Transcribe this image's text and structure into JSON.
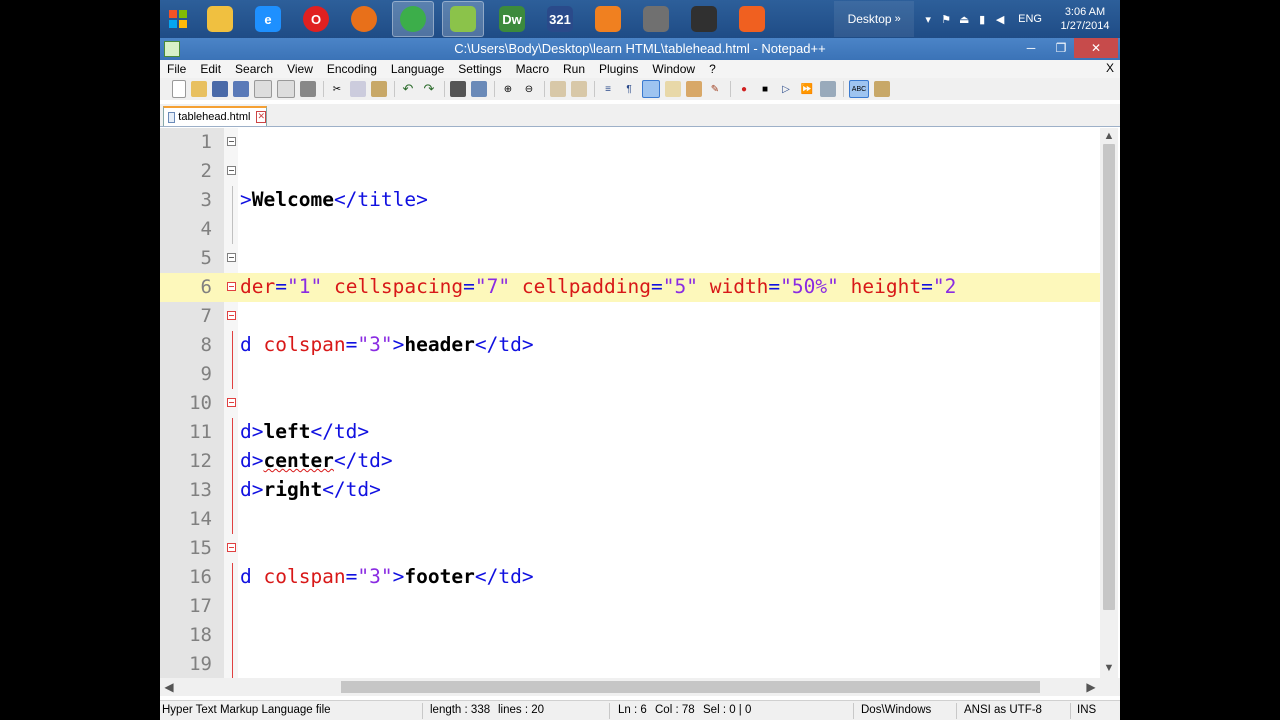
{
  "taskbar": {
    "apps": [
      {
        "name": "file-explorer",
        "label": "",
        "color": "#f0c040"
      },
      {
        "name": "internet-explorer",
        "label": "e",
        "color": "#1e90ff"
      },
      {
        "name": "opera",
        "label": "O",
        "color": "#e02020"
      },
      {
        "name": "firefox",
        "label": "",
        "color": "#e8701a"
      },
      {
        "name": "chrome",
        "label": "",
        "color": "#3cae4a"
      },
      {
        "name": "notepad-plus-plus",
        "label": "",
        "color": "#8bc34a"
      },
      {
        "name": "dreamweaver",
        "label": "Dw",
        "color": "#3c8a3c"
      },
      {
        "name": "media-player-321",
        "label": "321",
        "color": "#2a4a8a"
      },
      {
        "name": "vlc-player",
        "label": "",
        "color": "#f08020"
      },
      {
        "name": "app-placeholder",
        "label": "",
        "color": "#707070"
      },
      {
        "name": "video-app",
        "label": "",
        "color": "#303030"
      },
      {
        "name": "xampp",
        "label": "",
        "color": "#f06020"
      }
    ],
    "desktop_label": "Desktop",
    "language": "ENG",
    "time": "3:06 AM",
    "date": "1/27/2014"
  },
  "window": {
    "title": "C:\\Users\\Body\\Desktop\\learn HTML\\tablehead.html - Notepad++"
  },
  "menu": {
    "items": [
      "File",
      "Edit",
      "Search",
      "View",
      "Encoding",
      "Language",
      "Settings",
      "Macro",
      "Run",
      "Plugins",
      "Window",
      "?"
    ],
    "close": "X"
  },
  "tab": {
    "label": "tablehead.html"
  },
  "editor": {
    "highlighted_line": 6,
    "lines": [
      {
        "n": "1",
        "fold": "box",
        "code": []
      },
      {
        "n": "2",
        "fold": "box",
        "code": []
      },
      {
        "n": "3",
        "fold": "line",
        "code": [
          {
            "t": "tag",
            "v": ">"
          },
          {
            "t": "txt",
            "v": "Welcome"
          },
          {
            "t": "tag",
            "v": "</title>"
          }
        ]
      },
      {
        "n": "4",
        "fold": "line",
        "code": []
      },
      {
        "n": "5",
        "fold": "box",
        "code": []
      },
      {
        "n": "6",
        "fold": "boxred",
        "code": [
          {
            "t": "attr",
            "v": "der"
          },
          {
            "t": "tag",
            "v": "="
          },
          {
            "t": "val",
            "v": "\"1\""
          },
          {
            "t": "tag",
            "v": " "
          },
          {
            "t": "attr",
            "v": "cellspacing"
          },
          {
            "t": "tag",
            "v": "="
          },
          {
            "t": "val",
            "v": "\"7\""
          },
          {
            "t": "tag",
            "v": " "
          },
          {
            "t": "attr",
            "v": "cellpadding"
          },
          {
            "t": "tag",
            "v": "="
          },
          {
            "t": "val",
            "v": "\"5\""
          },
          {
            "t": "tag",
            "v": " "
          },
          {
            "t": "attr",
            "v": "width"
          },
          {
            "t": "tag",
            "v": "="
          },
          {
            "t": "val",
            "v": "\"50%\""
          },
          {
            "t": "tag",
            "v": " "
          },
          {
            "t": "attr",
            "v": "height"
          },
          {
            "t": "tag",
            "v": "="
          },
          {
            "t": "val",
            "v": "\"2"
          }
        ]
      },
      {
        "n": "7",
        "fold": "boxred",
        "code": []
      },
      {
        "n": "8",
        "fold": "linered",
        "code": [
          {
            "t": "tag",
            "v": "d "
          },
          {
            "t": "attr",
            "v": "colspan"
          },
          {
            "t": "tag",
            "v": "="
          },
          {
            "t": "val",
            "v": "\"3\""
          },
          {
            "t": "tag",
            "v": ">"
          },
          {
            "t": "txt",
            "v": "header"
          },
          {
            "t": "tag",
            "v": "</td>"
          }
        ]
      },
      {
        "n": "9",
        "fold": "linered",
        "code": []
      },
      {
        "n": "10",
        "fold": "boxred",
        "code": []
      },
      {
        "n": "11",
        "fold": "linered",
        "code": [
          {
            "t": "tag",
            "v": "d>"
          },
          {
            "t": "txt",
            "v": "left"
          },
          {
            "t": "tag",
            "v": "</td>"
          }
        ]
      },
      {
        "n": "12",
        "fold": "linered",
        "code": [
          {
            "t": "tag",
            "v": "d>"
          },
          {
            "t": "txtsq",
            "v": "center"
          },
          {
            "t": "tag",
            "v": "</td>"
          }
        ]
      },
      {
        "n": "13",
        "fold": "linered",
        "code": [
          {
            "t": "tag",
            "v": "d>"
          },
          {
            "t": "txt",
            "v": "right"
          },
          {
            "t": "tag",
            "v": "</td>"
          }
        ]
      },
      {
        "n": "14",
        "fold": "linered",
        "code": []
      },
      {
        "n": "15",
        "fold": "boxred",
        "code": []
      },
      {
        "n": "16",
        "fold": "linered",
        "code": [
          {
            "t": "tag",
            "v": "d "
          },
          {
            "t": "attr",
            "v": "colspan"
          },
          {
            "t": "tag",
            "v": "="
          },
          {
            "t": "val",
            "v": "\"3\""
          },
          {
            "t": "tag",
            "v": ">"
          },
          {
            "t": "txt",
            "v": "footer"
          },
          {
            "t": "tag",
            "v": "</td>"
          }
        ]
      },
      {
        "n": "17",
        "fold": "linered",
        "code": []
      },
      {
        "n": "18",
        "fold": "linered",
        "code": []
      },
      {
        "n": "19",
        "fold": "linered",
        "code": []
      }
    ]
  },
  "status": {
    "filetype": "Hyper Text Markup Language file",
    "length": "length : 338",
    "lines": "lines : 20",
    "ln": "Ln : 6",
    "col": "Col : 78",
    "sel": "Sel : 0 | 0",
    "eol": "Dos\\Windows",
    "encoding": "ANSI as UTF-8",
    "mode": "INS"
  },
  "colors": {
    "tag": "#1010e0",
    "attr": "#d81818",
    "value": "#8a2be2",
    "highlight": "#fdf8bb"
  }
}
